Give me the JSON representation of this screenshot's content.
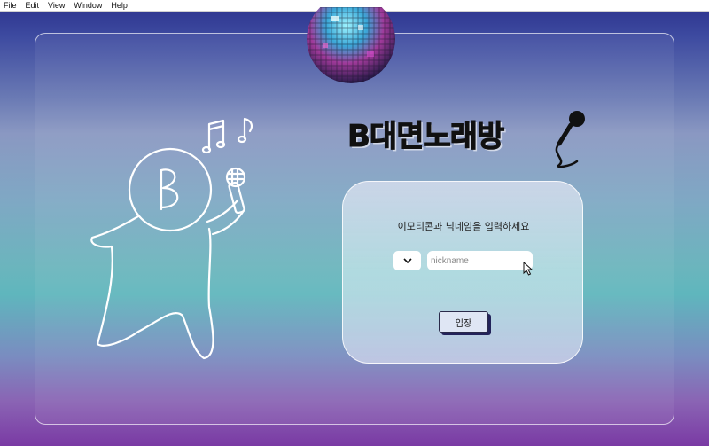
{
  "menubar": {
    "items": [
      "File",
      "Edit",
      "View",
      "Window",
      "Help"
    ]
  },
  "title": "B대면노래방",
  "login": {
    "prompt": "이모티콘과 닉네임을 입력하세요",
    "emoji_value": "",
    "nickname_placeholder": "nickname",
    "nickname_value": "",
    "enter_label": "입장"
  },
  "colors": {
    "bg_top": "#2a2f8a",
    "bg_mid": "#6bb5bd",
    "bg_bottom": "#7a3aa4",
    "button_shadow": "#23235a"
  },
  "icons": [
    "disco-ball-icon",
    "music-notes-icon",
    "character-icon",
    "microphone-icon",
    "chevron-down-icon",
    "mouse-cursor-icon"
  ]
}
